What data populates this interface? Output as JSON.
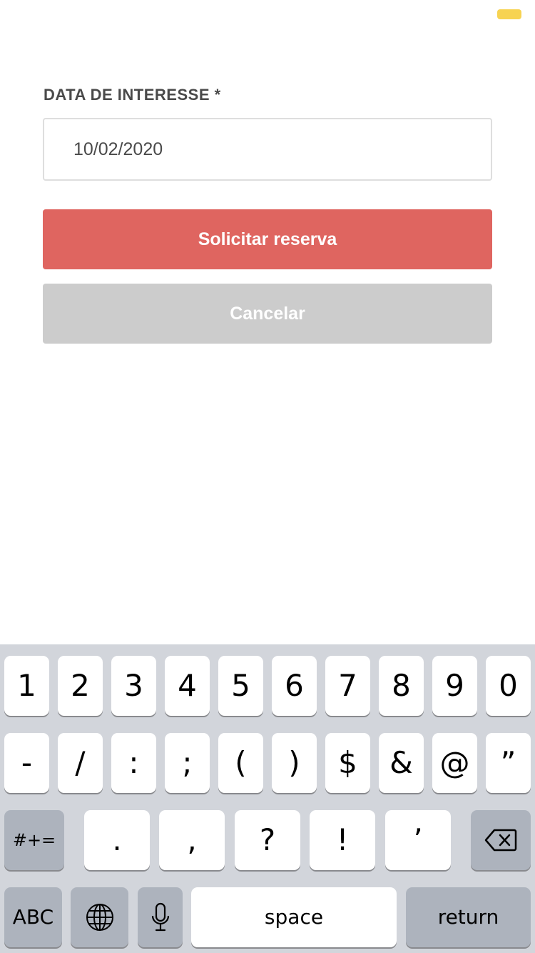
{
  "form": {
    "field_label": "DATA DE INTERESSE *",
    "date_value": "10/02/2020",
    "submit_label": "Solicitar reserva",
    "cancel_label": "Cancelar"
  },
  "colors": {
    "primary": "#df6560",
    "secondary": "#cccccc",
    "status_pill": "#f7d352"
  },
  "keyboard": {
    "row1": [
      "1",
      "2",
      "3",
      "4",
      "5",
      "6",
      "7",
      "8",
      "9",
      "0"
    ],
    "row2": [
      "-",
      "/",
      ":",
      ";",
      "(",
      ")",
      "$",
      "&",
      "@",
      "”"
    ],
    "row3": [
      "#+=",
      ".",
      ",",
      "?",
      "!",
      "’"
    ],
    "row3_icons": [
      "backspace-icon"
    ],
    "row4": [
      "ABC",
      "space",
      "return"
    ],
    "row4_icons": [
      "globe-icon",
      "microphone-icon"
    ]
  }
}
